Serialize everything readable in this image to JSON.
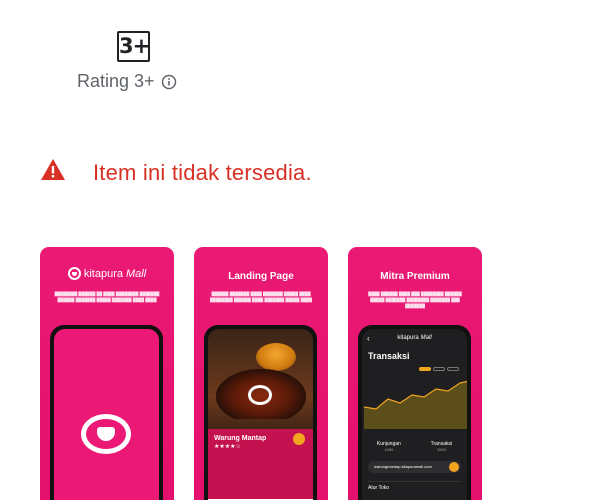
{
  "rating": {
    "badge": "3+",
    "label": "Rating 3+",
    "info_icon": "info-icon"
  },
  "unavailable": {
    "icon": "warning-icon",
    "message": "Item ini tidak tersedia.",
    "color": "#d93025"
  },
  "screenshots": [
    {
      "brand": "kitapura",
      "brand_suffix": "Mall",
      "accent": "#ea1a74"
    },
    {
      "title": "Landing Page",
      "store_name": "Warung Mantap",
      "accent": "#ea1a74"
    },
    {
      "title": "Mitra Premium",
      "brand": "kitapura",
      "brand_suffix": "Mall",
      "screen_title": "Transaksi",
      "stats": [
        {
          "label": "Kunjungan",
          "value": "1000"
        },
        {
          "label": "Transaksi",
          "value": "1000"
        }
      ],
      "email": "warungmantap.kitapuramall.com",
      "menu": "Atur Toko",
      "accent": "#f2a61f"
    }
  ]
}
